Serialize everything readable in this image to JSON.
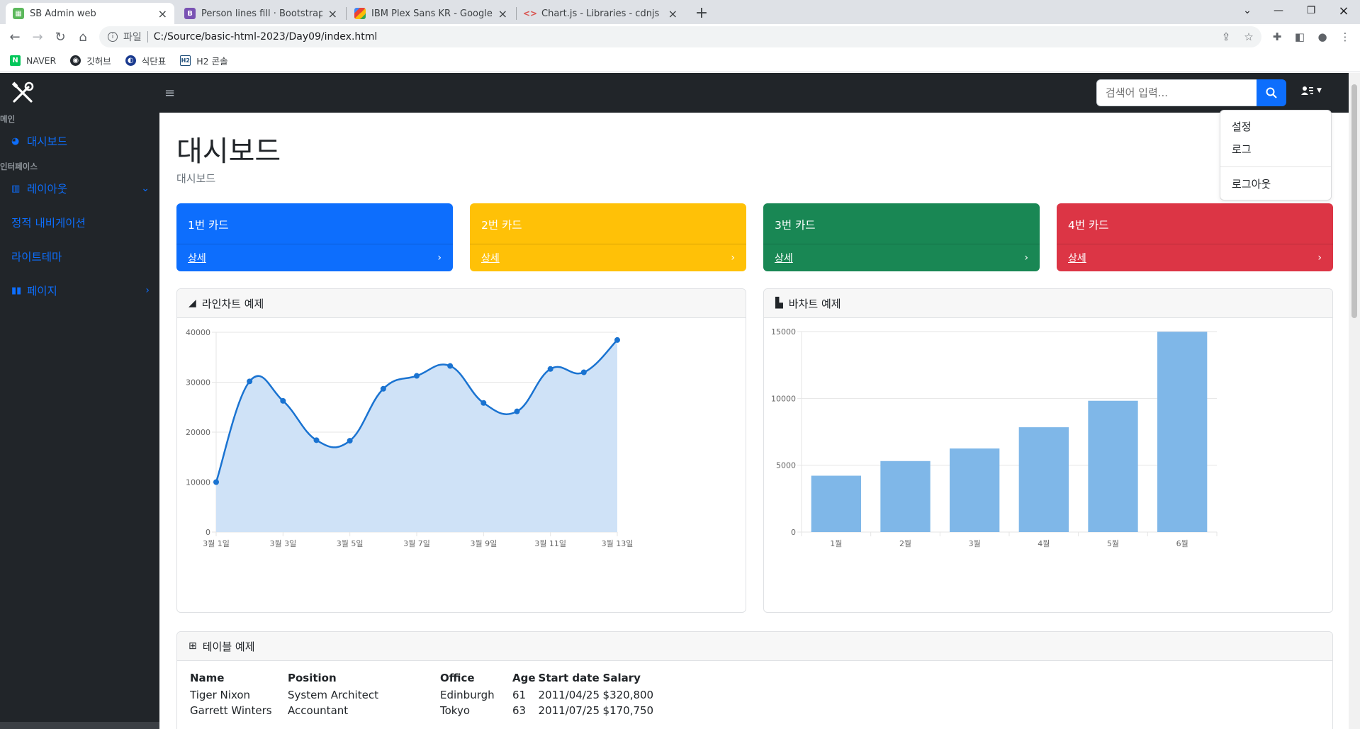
{
  "browser": {
    "tabs": [
      {
        "title": "SB Admin web",
        "icon": "sb-admin-favicon"
      },
      {
        "title": "Person lines fill · Bootstrap Icon",
        "icon": "bootstrap-favicon"
      },
      {
        "title": "IBM Plex Sans KR - Google Font",
        "icon": "google-fonts-favicon"
      },
      {
        "title": "Chart.js - Libraries - cdnjs - The",
        "icon": "cdnjs-favicon"
      }
    ],
    "url_scheme": "파일",
    "url": "C:/Source/basic-html-2023/Day09/index.html",
    "bookmarks": [
      {
        "label": "NAVER",
        "icon": "naver-icon"
      },
      {
        "label": "깃허브",
        "icon": "github-icon"
      },
      {
        "label": "식단표",
        "icon": "menu-icon"
      },
      {
        "label": "H2 콘솔",
        "icon": "h2-icon"
      }
    ]
  },
  "nav": {
    "search_placeholder": "검색어 입력...",
    "user_menu": {
      "items": [
        "설정",
        "로그",
        "로그아웃"
      ]
    }
  },
  "sidebar": {
    "headings": [
      "메인",
      "인터페이스"
    ],
    "items": [
      {
        "label": "대시보드",
        "icon": "dashboard-icon"
      },
      {
        "label": "레이아웃",
        "icon": "columns-icon"
      },
      {
        "label": "정적 내비게이션"
      },
      {
        "label": "라이트테마"
      },
      {
        "label": "페이지",
        "icon": "book-icon"
      }
    ]
  },
  "main": {
    "title": "대시보드",
    "breadcrumb": "대시보드",
    "cards": [
      {
        "title": "1번 카드",
        "link": "상세",
        "color": "#0d6efd"
      },
      {
        "title": "2번 카드",
        "link": "상세",
        "color": "#ffc107"
      },
      {
        "title": "3번 카드",
        "link": "상세",
        "color": "#198754"
      },
      {
        "title": "4번 카드",
        "link": "상세",
        "color": "#dc3545"
      }
    ],
    "line_chart_title": "라인차트 예제",
    "bar_chart_title": "바차트 예제",
    "table_title": "테이블 예제",
    "table": {
      "columns": [
        "Name",
        "Position",
        "Office",
        "Age",
        "Start date",
        "Salary"
      ],
      "rows": [
        [
          "Tiger Nixon",
          "System Architect",
          "Edinburgh",
          "61",
          "2011/04/25",
          "$320,800"
        ],
        [
          "Garrett Winters",
          "Accountant",
          "Tokyo",
          "63",
          "2011/07/25",
          "$170,750"
        ]
      ]
    }
  },
  "chart_data": [
    {
      "type": "area",
      "x": [
        "3월 1일",
        "3월 2일",
        "3월 3일",
        "3월 4일",
        "3월 5일",
        "3월 6일",
        "3월 7일",
        "3월 8일",
        "3월 9일",
        "3월 10일",
        "3월 11일",
        "3월 12일",
        "3월 13일"
      ],
      "x_tick_labels": [
        "3월 1일",
        "3월 3일",
        "3월 5일",
        "3월 7일",
        "3월 9일",
        "3월 11일",
        "3월 13일"
      ],
      "values": [
        10000,
        30162,
        26263,
        18394,
        18287,
        28682,
        31274,
        33259,
        25849,
        24159,
        32651,
        31984,
        38451
      ],
      "ylim": [
        0,
        40000
      ],
      "y_ticks": [
        0,
        10000,
        20000,
        30000,
        40000
      ],
      "color": "#0d6efd",
      "fill": "#cfe2f7",
      "grid": true
    },
    {
      "type": "bar",
      "categories": [
        "1월",
        "2월",
        "3월",
        "4월",
        "5월",
        "6월"
      ],
      "values": [
        4215,
        5312,
        6251,
        7841,
        9821,
        14984
      ],
      "ylim": [
        0,
        15000
      ],
      "y_ticks": [
        0,
        5000,
        10000,
        15000
      ],
      "color": "#7fb7e8",
      "grid": true
    }
  ]
}
